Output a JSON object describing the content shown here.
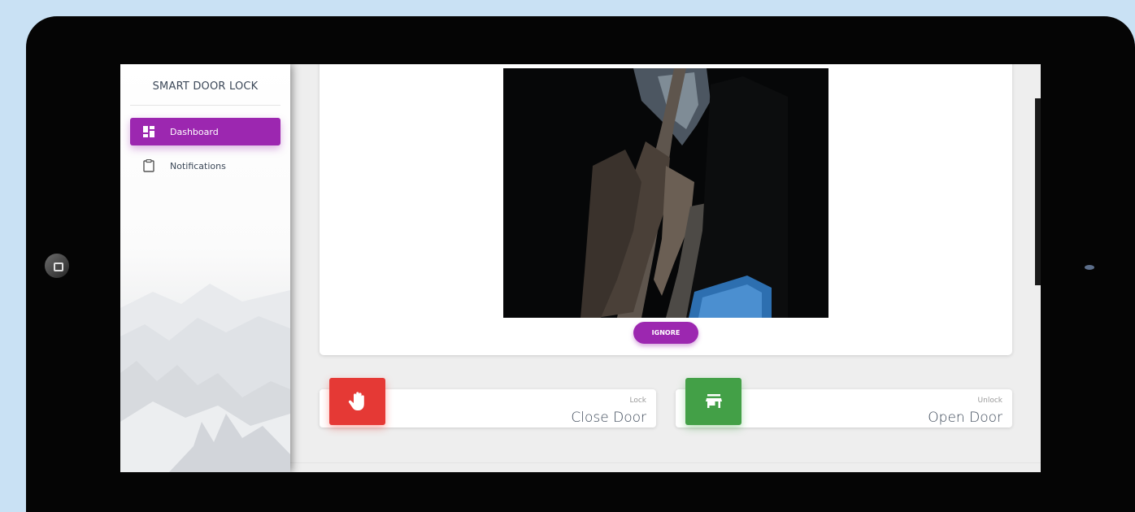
{
  "app": {
    "title": "SMART DOOR LOCK"
  },
  "sidebar": {
    "items": [
      {
        "label": "Dashboard",
        "icon": "dashboard-icon",
        "active": true
      },
      {
        "label": "Notifications",
        "icon": "clipboard-icon",
        "active": false
      }
    ]
  },
  "camera": {
    "ignore_label": "IGNORE"
  },
  "cards": [
    {
      "category": "Lock",
      "title": "Close Door",
      "icon": "hand-icon",
      "color": "#e53935"
    },
    {
      "category": "Unlock",
      "title": "Open Door",
      "icon": "store-icon",
      "color": "#43a047"
    }
  ],
  "colors": {
    "accent": "#9c27b0",
    "danger": "#e53935",
    "success": "#43a047"
  }
}
